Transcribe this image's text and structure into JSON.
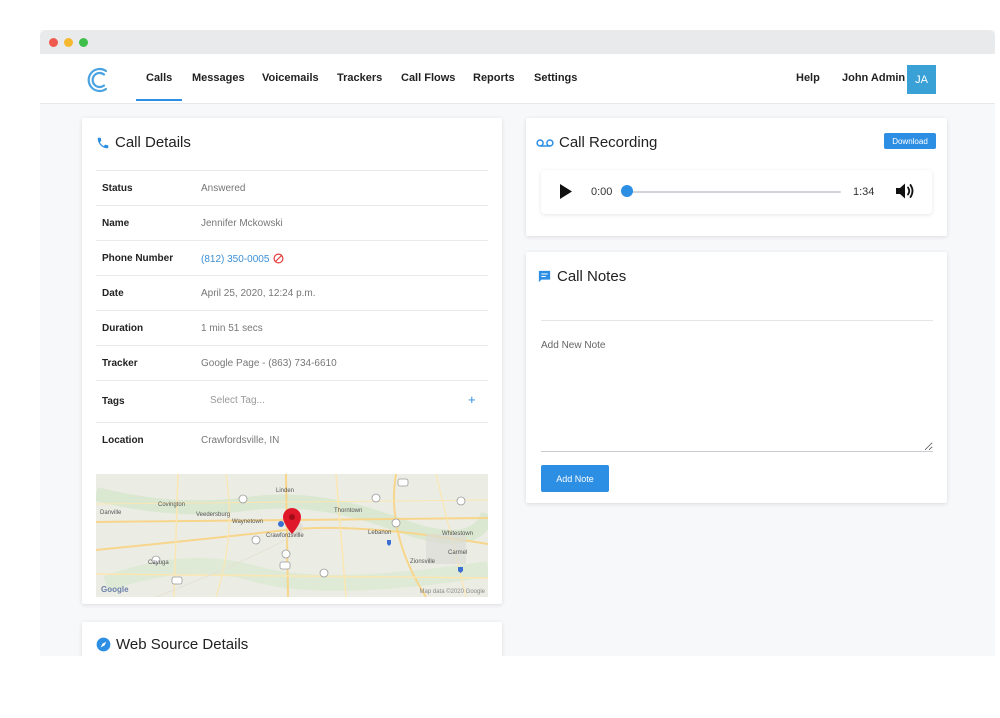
{
  "nav": {
    "items": [
      {
        "label": "Calls",
        "active": true
      },
      {
        "label": "Messages",
        "active": false
      },
      {
        "label": "Voicemails",
        "active": false
      },
      {
        "label": "Trackers",
        "active": false
      },
      {
        "label": "Call Flows",
        "active": false
      },
      {
        "label": "Reports",
        "active": false
      },
      {
        "label": "Settings",
        "active": false
      }
    ],
    "help_label": "Help",
    "user_name": "John Admin",
    "user_initials": "JA"
  },
  "call_details": {
    "title": "Call Details",
    "status_label": "Status",
    "status_value": "Answered",
    "name_label": "Name",
    "name_value": "Jennifer Mckowski",
    "phone_label": "Phone Number",
    "phone_value": "(812) 350-0005",
    "date_label": "Date",
    "date_value": "April 25, 2020, 12:24 p.m.",
    "duration_label": "Duration",
    "duration_value": "1 min 51 secs",
    "tracker_label": "Tracker",
    "tracker_value": "Google Page - (863) 734-6610",
    "tags_label": "Tags",
    "tags_placeholder": "Select Tag...",
    "tags_add": "+",
    "location_label": "Location",
    "location_value": "Crawfordsville, IN"
  },
  "map": {
    "places": [
      "Linden",
      "Covington",
      "Veedersburg",
      "Waynetown",
      "Thorntown",
      "Danville",
      "Crawfordsville",
      "Lebanon",
      "Whitestown",
      "Cayuga",
      "Zionsville",
      "Carmel"
    ],
    "google_label": "Google",
    "credit": "Map data ©2020 Google"
  },
  "recording": {
    "title": "Call Recording",
    "download_label": "Download",
    "current_time": "0:00",
    "total_time": "1:34",
    "progress": 0
  },
  "notes": {
    "title": "Call Notes",
    "placeholder": "Add New Note",
    "add_button_label": "Add Note"
  },
  "web_source": {
    "title": "Web Source Details"
  },
  "colors": {
    "accent": "#2d8fe3",
    "link": "#3c8fd6",
    "avatar": "#3aa1d6",
    "map_pin": "#e0192a"
  }
}
